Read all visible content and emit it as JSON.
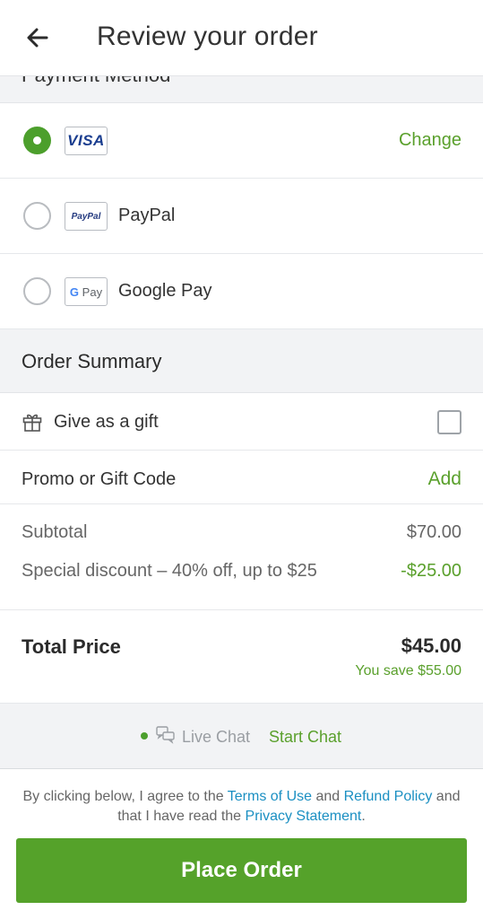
{
  "header": {
    "title": "Review your order"
  },
  "payment": {
    "section_label": "Payment Method",
    "change_label": "Change",
    "methods": [
      {
        "label": "",
        "logo_text": "VISA",
        "selected": true
      },
      {
        "label": "PayPal",
        "logo_text": "PayPal",
        "selected": false
      },
      {
        "label": "Google Pay",
        "logo_g": "G",
        "logo_text": "Pay",
        "selected": false
      }
    ]
  },
  "summary": {
    "heading": "Order Summary",
    "gift_label": "Give as a gift",
    "gift_checked": false,
    "promo_label": "Promo or Gift Code",
    "promo_action": "Add",
    "subtotal_label": "Subtotal",
    "subtotal_value": "$70.00",
    "discount_label": "Special discount – 40% off, up to $25",
    "discount_value": "-$25.00",
    "total_label": "Total Price",
    "total_value": "$45.00",
    "savings": "You save $55.00"
  },
  "chat": {
    "status_label": "Live Chat",
    "action": "Start Chat"
  },
  "footer": {
    "legal_prefix": "By clicking below, I agree to the ",
    "terms_link": "Terms of Use",
    "and_text": " and ",
    "refund_link": "Refund Policy",
    "middle_text": " and that I have read the ",
    "privacy_link": "Privacy Statement",
    "period": ".",
    "place_order": "Place Order"
  },
  "colors": {
    "accent_green": "#55a22a",
    "link_blue": "#1a8fc2",
    "section_bg": "#f2f3f5"
  }
}
